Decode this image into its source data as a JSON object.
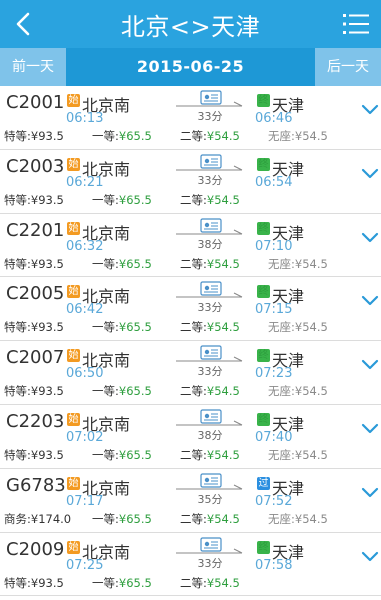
{
  "header": {
    "title": "北京<>天津",
    "back_icon": "back-arrow-icon",
    "menu_icon": "menu-icon"
  },
  "datebar": {
    "prev_label": "前一天",
    "date": "2015-06-25",
    "next_label": "后一天"
  },
  "colors": {
    "header": "#2aa3df",
    "datebar": "#1e98d6",
    "origin_badge": "#f39a21",
    "terminal_badge": "#39b34a",
    "passing_badge": "#2b8fe0",
    "price_green": "#2e9e3e"
  },
  "trains": [
    {
      "train_no": "C2001",
      "from_badge": "始",
      "from": "北京南",
      "dep": "06:13",
      "duration": "33分",
      "to_badge": "终",
      "to_badge_type": "terminal",
      "to": "天津",
      "arr": "06:46",
      "seats": [
        {
          "label": "特等:",
          "price": "¥93.5"
        },
        {
          "label": "一等:",
          "price": "¥65.5"
        },
        {
          "label": "二等:",
          "price": "¥54.5"
        },
        {
          "label": "无座:",
          "price": "¥54.5"
        }
      ]
    },
    {
      "train_no": "C2003",
      "from_badge": "始",
      "from": "北京南",
      "dep": "06:21",
      "duration": "33分",
      "to_badge": "终",
      "to_badge_type": "terminal",
      "to": "天津",
      "arr": "06:54",
      "seats": [
        {
          "label": "特等:",
          "price": "¥93.5"
        },
        {
          "label": "一等:",
          "price": "¥65.5"
        },
        {
          "label": "二等:",
          "price": "¥54.5"
        },
        {
          "label": "",
          "price": ""
        }
      ]
    },
    {
      "train_no": "C2201",
      "from_badge": "始",
      "from": "北京南",
      "dep": "06:32",
      "duration": "38分",
      "to_badge": "终",
      "to_badge_type": "terminal",
      "to": "天津",
      "arr": "07:10",
      "seats": [
        {
          "label": "特等:",
          "price": "¥93.5"
        },
        {
          "label": "一等:",
          "price": "¥65.5"
        },
        {
          "label": "二等:",
          "price": "¥54.5"
        },
        {
          "label": "无座:",
          "price": "¥54.5"
        }
      ]
    },
    {
      "train_no": "C2005",
      "from_badge": "始",
      "from": "北京南",
      "dep": "06:42",
      "duration": "33分",
      "to_badge": "终",
      "to_badge_type": "terminal",
      "to": "天津",
      "arr": "07:15",
      "seats": [
        {
          "label": "特等:",
          "price": "¥93.5"
        },
        {
          "label": "一等:",
          "price": "¥65.5"
        },
        {
          "label": "二等:",
          "price": "¥54.5"
        },
        {
          "label": "无座:",
          "price": "¥54.5"
        }
      ]
    },
    {
      "train_no": "C2007",
      "from_badge": "始",
      "from": "北京南",
      "dep": "06:50",
      "duration": "33分",
      "to_badge": "终",
      "to_badge_type": "terminal",
      "to": "天津",
      "arr": "07:23",
      "seats": [
        {
          "label": "特等:",
          "price": "¥93.5"
        },
        {
          "label": "一等:",
          "price": "¥65.5"
        },
        {
          "label": "二等:",
          "price": "¥54.5"
        },
        {
          "label": "无座:",
          "price": "¥54.5"
        }
      ]
    },
    {
      "train_no": "C2203",
      "from_badge": "始",
      "from": "北京南",
      "dep": "07:02",
      "duration": "38分",
      "to_badge": "终",
      "to_badge_type": "terminal",
      "to": "天津",
      "arr": "07:40",
      "seats": [
        {
          "label": "特等:",
          "price": "¥93.5"
        },
        {
          "label": "一等:",
          "price": "¥65.5"
        },
        {
          "label": "二等:",
          "price": "¥54.5"
        },
        {
          "label": "无座:",
          "price": "¥54.5"
        }
      ]
    },
    {
      "train_no": "G6783",
      "from_badge": "始",
      "from": "北京南",
      "dep": "07:17",
      "duration": "35分",
      "to_badge": "过",
      "to_badge_type": "passing",
      "to": "天津",
      "arr": "07:52",
      "seats": [
        {
          "label": "商务:",
          "price": "¥174.0"
        },
        {
          "label": "一等:",
          "price": "¥65.5"
        },
        {
          "label": "二等:",
          "price": "¥54.5"
        },
        {
          "label": "无座:",
          "price": "¥54.5"
        }
      ]
    },
    {
      "train_no": "C2009",
      "from_badge": "始",
      "from": "北京南",
      "dep": "07:25",
      "duration": "33分",
      "to_badge": "终",
      "to_badge_type": "terminal",
      "to": "天津",
      "arr": "07:58",
      "seats": [
        {
          "label": "特等:",
          "price": "¥93.5"
        },
        {
          "label": "一等:",
          "price": "¥65.5"
        },
        {
          "label": "二等:",
          "price": "¥54.5"
        },
        {
          "label": "",
          "price": ""
        }
      ]
    }
  ]
}
